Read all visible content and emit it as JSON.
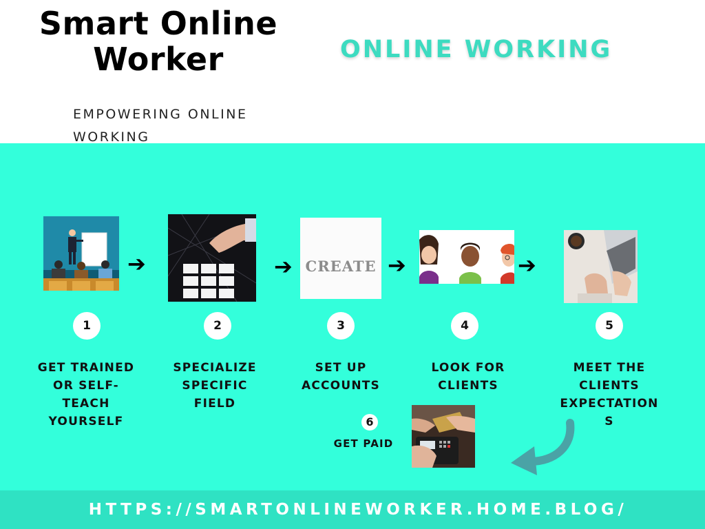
{
  "header": {
    "brand_title": "Smart Online Worker",
    "tagline": "EMPOWERING ONLINE WORKING",
    "headline": "ONLINE WORKING"
  },
  "steps": [
    {
      "number": "1",
      "label": "GET TRAINED\nOR SELF-\nTEACH\nYOURSELF",
      "image": "presentation-image"
    },
    {
      "number": "2",
      "label": "SPECIALIZE\nSPECIFIC\nFIELD",
      "image": "hand-placing-block-image"
    },
    {
      "number": "3",
      "label": "SET UP\nACCOUNTS",
      "image": "create-word-image",
      "image_text": "CREATE"
    },
    {
      "number": "4",
      "label": "LOOK FOR\nCLIENTS",
      "image": "people-avatars-image"
    },
    {
      "number": "5",
      "label": "MEET THE\nCLIENTS\nEXPECTATION\nS",
      "image": "typing-laptop-image"
    },
    {
      "number": "6",
      "label": "GET PAID",
      "image": "card-payment-image"
    }
  ],
  "footer": {
    "url": "HTTPS://SMARTONLINEWORKER.HOME.BLOG/"
  },
  "colors": {
    "panel": "#33ffdb",
    "footer": "#2fe2c3",
    "headline": "#3ddbc0",
    "return_arrow": "#4aa3a6"
  },
  "icons": {
    "flow_arrow": "arrow-right-icon",
    "return_arrow": "curved-arrow-icon"
  }
}
